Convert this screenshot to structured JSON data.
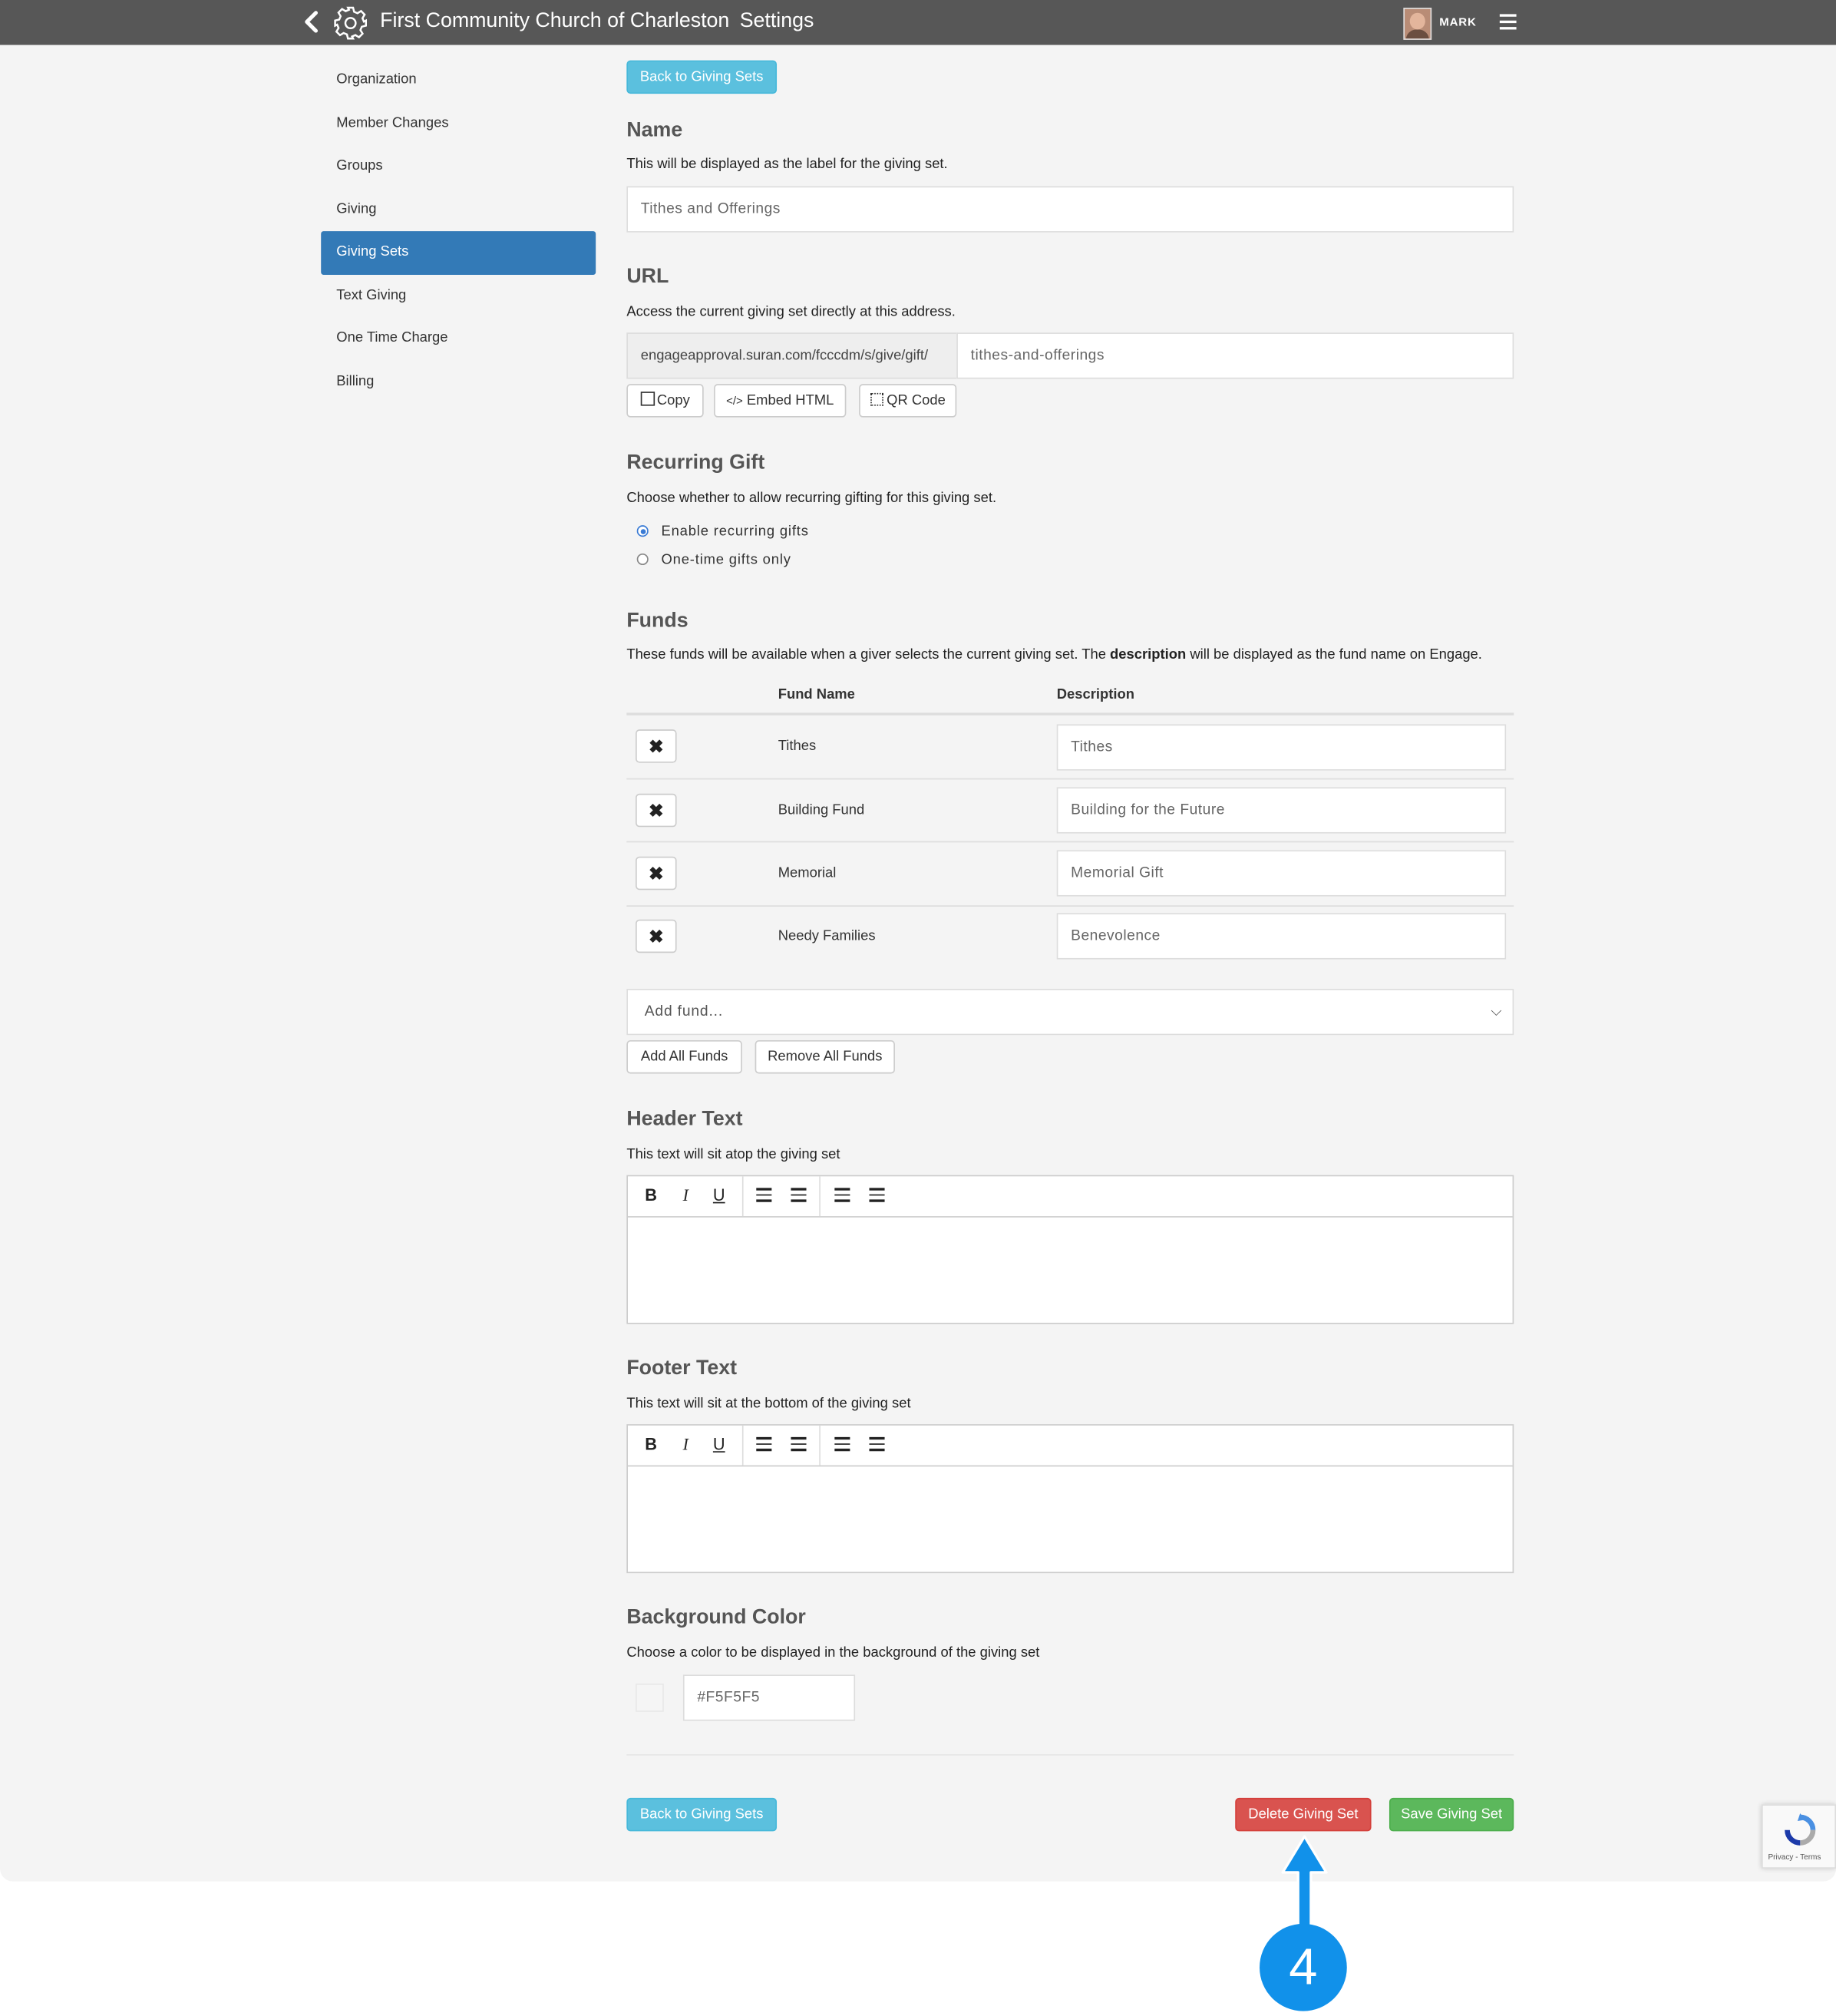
{
  "header": {
    "org_name": "First Community Church of Charleston",
    "section": "Settings",
    "user": "MARK",
    "icons": [
      "chevron-left-icon",
      "gear-icon",
      "avatar",
      "menu-icon"
    ]
  },
  "sidebar": {
    "items": [
      {
        "label": "Organization"
      },
      {
        "label": "Member Changes"
      },
      {
        "label": "Groups"
      },
      {
        "label": "Giving"
      },
      {
        "label": "Giving Sets",
        "active": true
      },
      {
        "label": "Text Giving"
      },
      {
        "label": "One Time Charge"
      },
      {
        "label": "Billing"
      }
    ]
  },
  "form": {
    "back_label": "Back to Giving Sets",
    "name": {
      "heading": "Name",
      "help": "This will be displayed as the label for the giving set.",
      "value": "Tithes and Offerings"
    },
    "url": {
      "heading": "URL",
      "help": "Access the current giving set directly at this address.",
      "prefix": "engageapproval.suran.com/fcccdm/s/give/gift/",
      "slug": "tithes-and-offerings",
      "copy_label": "Copy",
      "embed_label": "Embed HTML",
      "qr_label": "QR Code"
    },
    "recurring": {
      "heading": "Recurring Gift",
      "help": "Choose whether to allow recurring gifting for this giving set.",
      "options": [
        {
          "label": "Enable recurring gifts",
          "selected": true
        },
        {
          "label": "One-time gifts only",
          "selected": false
        }
      ]
    },
    "funds": {
      "heading": "Funds",
      "help_before": "These funds will be available when a giver selects the current giving set. The ",
      "help_bold": "description",
      "help_after": " will be displayed as the fund name on Engage.",
      "col_name": "Fund Name",
      "col_desc": "Description",
      "rows": [
        {
          "name": "Tithes",
          "description": "Tithes"
        },
        {
          "name": "Building Fund",
          "description": "Building for the Future"
        },
        {
          "name": "Memorial",
          "description": "Memorial Gift"
        },
        {
          "name": "Needy Families",
          "description": "Benevolence"
        }
      ],
      "remove_glyph": "✖",
      "add_placeholder": "Add fund...",
      "add_all_label": "Add All Funds",
      "remove_all_label": "Remove All Funds"
    },
    "header_text": {
      "heading": "Header Text",
      "help": "This text will sit atop the giving set"
    },
    "footer_text": {
      "heading": "Footer Text",
      "help": "This text will sit at the bottom of the giving set"
    },
    "editor_toolbar": {
      "bold": "B",
      "italic": "I",
      "underline": "U"
    },
    "background": {
      "heading": "Background Color",
      "help": "Choose a color to be displayed in the background of the giving set",
      "value": "#F5F5F5"
    },
    "delete_label": "Delete Giving Set",
    "save_label": "Save Giving Set"
  },
  "recaptcha": {
    "text": "Privacy - Terms"
  },
  "callout": {
    "number": "4"
  },
  "colors": {
    "topbar": "#575757",
    "active_nav": "#337ab7",
    "info": "#5bc0de",
    "danger": "#d9534f",
    "success": "#5cb85c",
    "callout": "#1191ea"
  }
}
